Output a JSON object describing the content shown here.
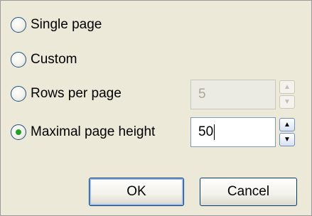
{
  "options": [
    {
      "label": "Single page",
      "checked": false
    },
    {
      "label": "Custom",
      "checked": false
    },
    {
      "label": "Rows per page",
      "checked": false
    },
    {
      "label": "Maximal page height",
      "checked": true
    }
  ],
  "rows_per_page": {
    "value": "5",
    "enabled": false
  },
  "max_page_height": {
    "value": "50",
    "enabled": true
  },
  "buttons": {
    "ok": "OK",
    "cancel": "Cancel"
  }
}
